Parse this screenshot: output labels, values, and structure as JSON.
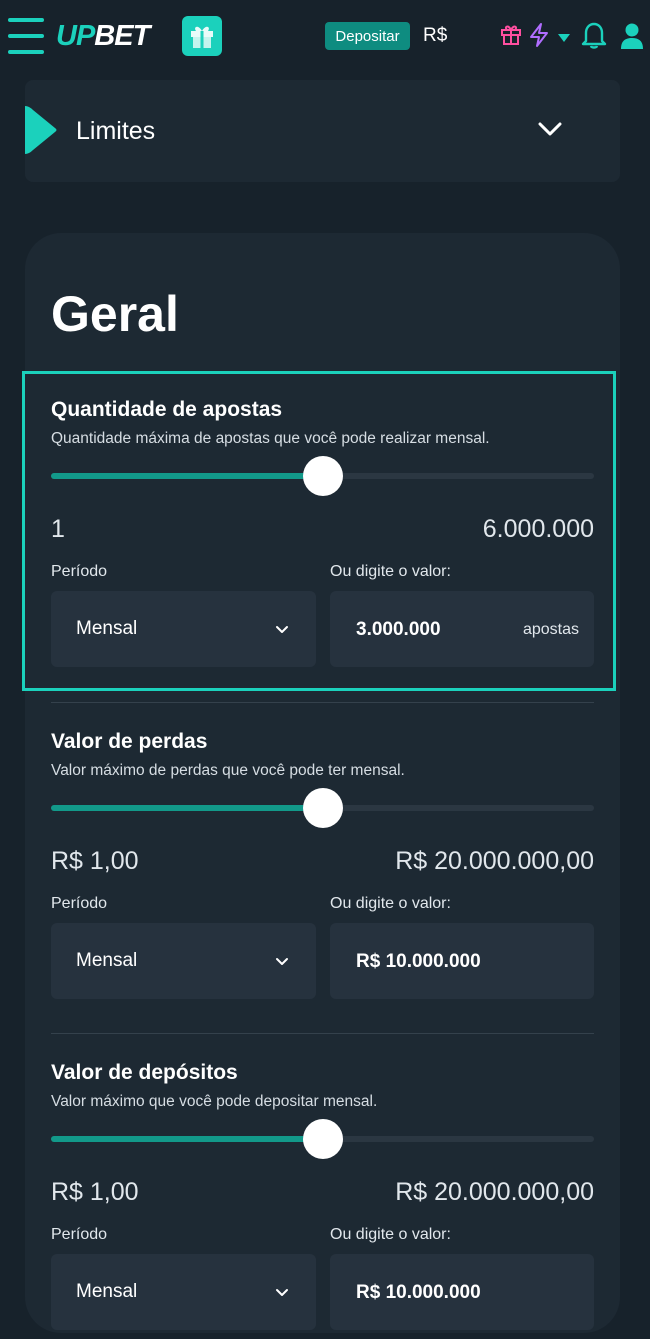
{
  "header": {
    "logo_prefix": "UP",
    "logo_suffix": "BET",
    "deposit_label": "Depositar",
    "currency": "R$",
    "colors": {
      "accent": "#1bd1bc",
      "pink": "#ff4fa0",
      "violet": "#b06dff"
    },
    "icons": [
      "menu-icon",
      "gift-icon",
      "gift-outline-icon",
      "lightning-icon",
      "caret-down-icon",
      "bell-icon",
      "user-icon"
    ]
  },
  "limites": {
    "title": "Limites"
  },
  "main": {
    "title": "Geral",
    "sections": [
      {
        "title": "Quantidade de apostas",
        "description": "Quantidade máxima de apostas que você pode realizar mensal.",
        "slider_fraction": 0.5,
        "min_label": "1",
        "max_label": "6.000.000",
        "period_label": "Período",
        "period_value": "Mensal",
        "input_label": "Ou digite o valor:",
        "input_value": "3.000.000",
        "input_suffix": "apostas"
      },
      {
        "title": "Valor de perdas",
        "description": "Valor máximo de perdas que você pode ter mensal.",
        "slider_fraction": 0.5,
        "min_label": "R$ 1,00",
        "max_label": "R$ 20.000.000,00",
        "period_label": "Período",
        "period_value": "Mensal",
        "input_label": "Ou digite o valor:",
        "input_value": "R$ 10.000.000",
        "input_suffix": ""
      },
      {
        "title": "Valor de depósitos",
        "description": "Valor máximo que você pode depositar mensal.",
        "slider_fraction": 0.5,
        "min_label": "R$ 1,00",
        "max_label": "R$ 20.000.000,00",
        "period_label": "Período",
        "period_value": "Mensal",
        "input_label": "Ou digite o valor:",
        "input_value": "R$ 10.000.000",
        "input_suffix": ""
      }
    ]
  }
}
